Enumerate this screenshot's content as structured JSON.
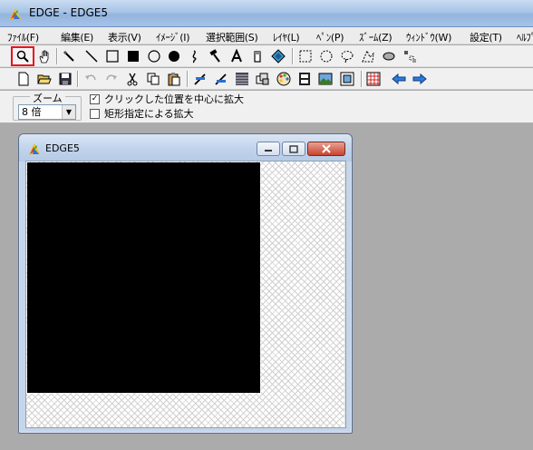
{
  "window": {
    "title": "EDGE - EDGE5"
  },
  "menu": [
    "ﾌｧｲﾙ(F)",
    "編集(E)",
    "表示(V)",
    "ｲﾒｰｼﾞ(I)",
    "選択範囲(S)",
    "ﾚｲﾔ(L)",
    "ﾍﾟﾝ(P)",
    "ｽﾞｰﾑ(Z)",
    "ｳｨﾝﾄﾞｳ(W)",
    "設定(T)",
    "ﾍﾙﾌﾟ"
  ],
  "toolbar1": {
    "tools": [
      "zoom-tool-icon",
      "hand-tool-icon",
      "pencil-tool-icon",
      "line-tool-icon",
      "rectangle-tool-icon",
      "filled-rectangle-tool-icon",
      "ellipse-tool-icon",
      "filled-ellipse-tool-icon",
      "curve-tool-icon",
      "hammer-tool-icon",
      "text-tool-icon",
      "eraser-tool-icon",
      "fill-tool-icon",
      "rect-select-tool-icon",
      "ellipse-select-tool-icon",
      "lasso-select-tool-icon",
      "polygon-select-tool-icon",
      "cloud-select-tool-icon",
      "pattern-tool-icon"
    ],
    "selected": "zoom-tool-icon"
  },
  "toolbar2": {
    "tools": [
      "new-file-icon",
      "open-file-icon",
      "save-file-icon",
      "undo-icon",
      "redo-icon",
      "cut-icon",
      "copy-icon",
      "paste-icon",
      "pen-setting-icon",
      "pen-setting2-icon",
      "grid-icon",
      "layer-icon",
      "palette-icon",
      "film-icon",
      "image-icon",
      "canvas-icon",
      "grid-red-icon",
      "arrow-left-icon",
      "arrow-right-icon"
    ]
  },
  "options": {
    "zoom_group_label": "ズーム",
    "zoom_value": "8 倍",
    "checkbox1_label": "クリックした位置を中心に拡大",
    "checkbox1_checked": true,
    "checkbox2_label": "矩形指定による拡大",
    "checkbox2_checked": false
  },
  "child_window": {
    "title": "EDGE5"
  },
  "colors": {
    "selected_border": "#e8141b",
    "canvas_image": "#000000",
    "mdi_background": "#ababab"
  }
}
